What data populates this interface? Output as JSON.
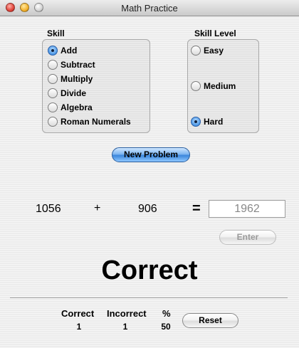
{
  "window": {
    "title": "Math Practice"
  },
  "skill": {
    "label": "Skill",
    "options": [
      "Add",
      "Subtract",
      "Multiply",
      "Divide",
      "Algebra",
      "Roman Numerals"
    ],
    "selected": "Add"
  },
  "level": {
    "label": "Skill Level",
    "options": [
      "Easy",
      "Medium",
      "Hard"
    ],
    "selected": "Hard"
  },
  "new_problem_label": "New Problem",
  "problem": {
    "operand1": "1056",
    "operator": "+",
    "operand2": "906",
    "equals": "=",
    "answer": "1962"
  },
  "enter_label": "Enter",
  "result_text": "Correct",
  "stats": {
    "correct_label": "Correct",
    "incorrect_label": "Incorrect",
    "percent_label": "%",
    "correct": "1",
    "incorrect": "1",
    "percent": "50"
  },
  "reset_label": "Reset"
}
